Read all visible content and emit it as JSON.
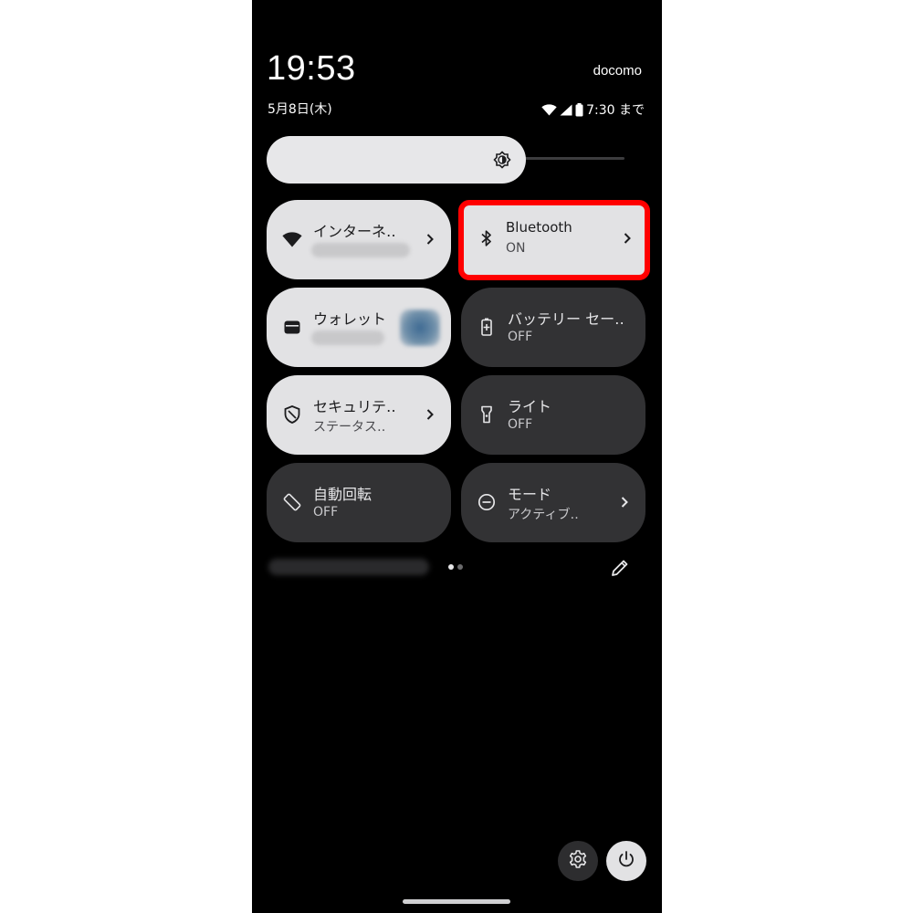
{
  "status_bar": {
    "time": "19:53",
    "carrier": "docomo",
    "date": "5月8日(木)",
    "alarm_text": "7:30 まで"
  },
  "brightness": {
    "level_fraction": 0.72,
    "icon": "brightness-auto-icon"
  },
  "tiles": {
    "internet": {
      "title": "インターネ‥",
      "icon": "wifi-icon",
      "state": "on"
    },
    "bluetooth": {
      "title": "Bluetooth",
      "subtitle": "ON",
      "icon": "bluetooth-icon",
      "state": "on",
      "highlighted": true
    },
    "wallet": {
      "title": "ウォレット",
      "icon": "wallet-icon",
      "state": "on"
    },
    "battery_saver": {
      "title": "バッテリー セー‥",
      "subtitle": "OFF",
      "icon": "battery-saver-icon",
      "state": "off"
    },
    "security": {
      "title": "セキュリテ‥",
      "subtitle": "ステータス‥",
      "icon": "shield-icon",
      "state": "on"
    },
    "flashlight": {
      "title": "ライト",
      "subtitle": "OFF",
      "icon": "flashlight-icon",
      "state": "off"
    },
    "auto_rotate": {
      "title": "自動回転",
      "subtitle": "OFF",
      "icon": "rotate-icon",
      "state": "off"
    },
    "mode": {
      "title": "モード",
      "subtitle": "アクティブ‥",
      "icon": "minus-circle-icon",
      "state": "off"
    }
  },
  "pager": {
    "pages": 2,
    "current": 1
  },
  "colors": {
    "background": "#000000",
    "tile_on": "#e2e2e4",
    "tile_off": "#323234",
    "highlight": "#ff0000"
  }
}
